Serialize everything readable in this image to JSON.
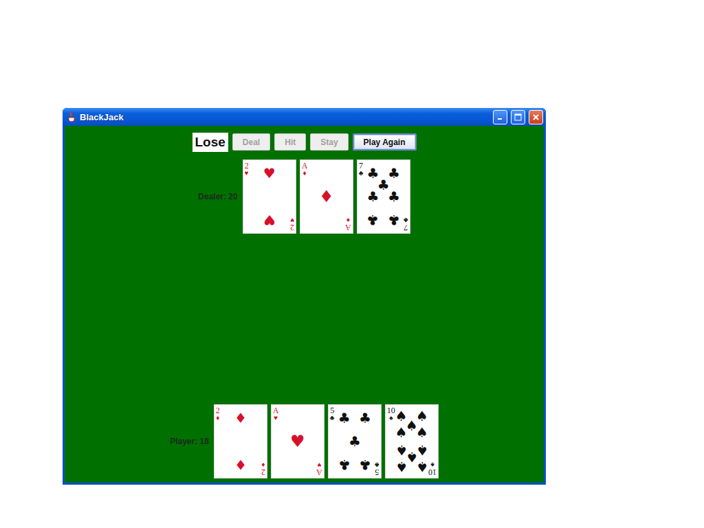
{
  "window": {
    "title": "BlackJack"
  },
  "status": {
    "label": "Lose"
  },
  "buttons": [
    {
      "label": "Deal",
      "disabled": true,
      "focused": false
    },
    {
      "label": "Hit",
      "disabled": true,
      "focused": false
    },
    {
      "label": "Stay",
      "disabled": true,
      "focused": false
    },
    {
      "label": "Play Again",
      "disabled": false,
      "focused": true
    }
  ],
  "dealer": {
    "label": "Dealer: 20",
    "cards": [
      {
        "rank": "2",
        "suit": "♥",
        "color": "#d8102a"
      },
      {
        "rank": "A",
        "suit": "♦",
        "color": "#d8102a"
      },
      {
        "rank": "7",
        "suit": "♣",
        "color": "#111111"
      }
    ]
  },
  "player": {
    "label": "Player: 18",
    "cards": [
      {
        "rank": "2",
        "suit": "♦",
        "color": "#d8102a"
      },
      {
        "rank": "A",
        "suit": "♥",
        "color": "#d8102a"
      },
      {
        "rank": "5",
        "suit": "♣",
        "color": "#111111"
      },
      {
        "rank": "10",
        "suit": "♠",
        "color": "#111111"
      }
    ]
  }
}
